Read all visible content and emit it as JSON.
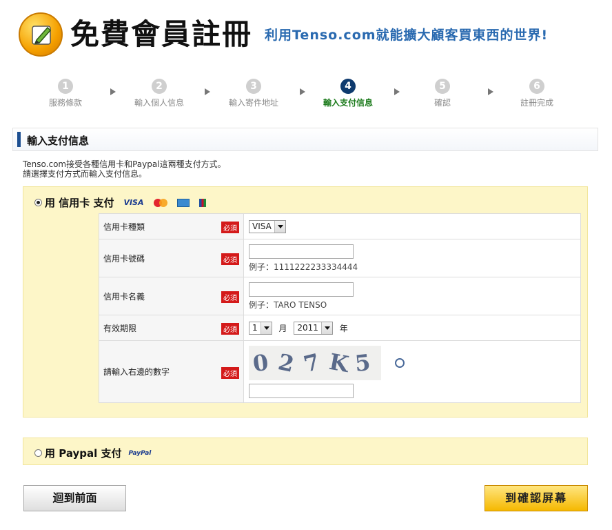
{
  "header": {
    "title": "免費會員註冊",
    "subtitle": "利用Tenso.com就能擴大顧客買東西的世界!"
  },
  "steps": [
    {
      "num": "1",
      "label": "服務條款"
    },
    {
      "num": "2",
      "label": "輸入個人信息"
    },
    {
      "num": "3",
      "label": "輸入寄件地址"
    },
    {
      "num": "4",
      "label": "輸入支付信息"
    },
    {
      "num": "5",
      "label": "確認"
    },
    {
      "num": "6",
      "label": "註冊完成"
    }
  ],
  "active_step": 4,
  "section": {
    "title": "輸入支付信息"
  },
  "description": {
    "line1": "Tenso.com接受各種信用卡和Paypal這兩種支付方式。",
    "line2": "請選擇支付方式而輸入支付信息。"
  },
  "credit": {
    "option_label": "用 信用卡 支付",
    "visa_text": "VISA",
    "required_badge": "必須",
    "fields": {
      "card_type": {
        "label": "信用卡種類",
        "value": "VISA"
      },
      "card_number": {
        "label": "信用卡號碼",
        "example": "例子：1111222233334444"
      },
      "card_name": {
        "label": "信用卡名義",
        "example": "例子：TARO TENSO"
      },
      "expiry": {
        "label": "有效期限",
        "month": "1",
        "month_unit": "月",
        "year": "2011",
        "year_unit": "年"
      },
      "captcha": {
        "label": "請輸入右邊的數字",
        "text": "027K5"
      }
    }
  },
  "paypal": {
    "option_label": "用 Paypal 支付",
    "logo_text": "PayPal"
  },
  "buttons": {
    "back": "迴到前面",
    "next": "到確認屏幕"
  },
  "colors": {
    "panel_bg": "#fdf6c8",
    "active_step": "#0e3a6e",
    "active_label": "#1a7a1a",
    "required": "#d41a1a",
    "next_button": "#f5b800",
    "subtitle": "#2a6ab0"
  }
}
